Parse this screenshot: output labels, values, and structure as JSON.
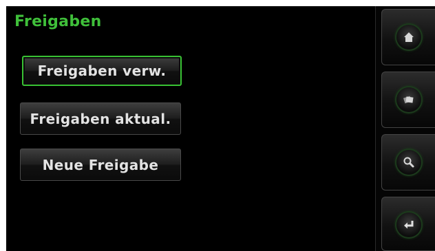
{
  "screen": {
    "title": "Freigaben"
  },
  "menu": {
    "items": [
      {
        "label": "Freigaben verw.",
        "selected": true
      },
      {
        "label": "Freigaben aktual.",
        "selected": false
      },
      {
        "label": "Neue Freigabe",
        "selected": false
      }
    ]
  },
  "sidebar": {
    "buttons": [
      {
        "icon": "home-icon"
      },
      {
        "icon": "cards-icon"
      },
      {
        "icon": "search-icon"
      },
      {
        "icon": "back-enter-icon"
      }
    ]
  },
  "colors": {
    "accent": "#3fbf3a",
    "background": "#000000",
    "button_text": "#e3e3e3"
  }
}
